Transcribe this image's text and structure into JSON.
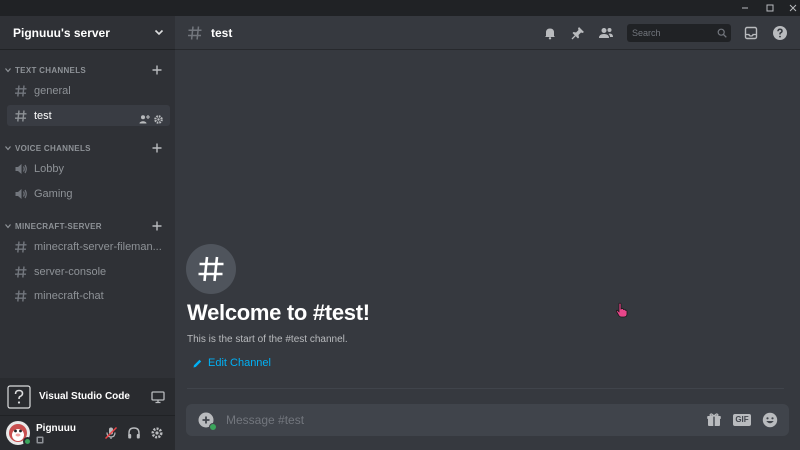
{
  "window": {
    "controls": [
      "minimize-icon",
      "maximize-icon",
      "close-icon"
    ]
  },
  "server": {
    "name": "Pignuuu's server"
  },
  "categories": [
    {
      "label": "TEXT CHANNELS",
      "channels": [
        {
          "label": "general",
          "type": "text",
          "icon": "hash-icon",
          "active": false
        },
        {
          "label": "test",
          "type": "text",
          "icon": "hash-icon",
          "active": true
        }
      ]
    },
    {
      "label": "VOICE CHANNELS",
      "channels": [
        {
          "label": "Lobby",
          "type": "voice",
          "icon": "speaker-icon",
          "active": false
        },
        {
          "label": "Gaming",
          "type": "voice",
          "icon": "speaker-icon",
          "active": false
        }
      ]
    },
    {
      "label": "MINECRAFT-SERVER",
      "channels": [
        {
          "label": "minecraft-server-fileman...",
          "type": "text",
          "icon": "hash-icon",
          "active": false
        },
        {
          "label": "server-console",
          "type": "text",
          "icon": "hash-icon",
          "active": false
        },
        {
          "label": "minecraft-chat",
          "type": "text",
          "icon": "hash-icon",
          "active": false
        }
      ]
    }
  ],
  "activity": {
    "name": "Visual Studio Code",
    "icon": "question-mark-icon"
  },
  "user": {
    "name": "Pignuuu",
    "status_color": "#3ba55c",
    "controls": [
      "mute-mic-icon",
      "headphones-icon",
      "settings-gear-icon"
    ]
  },
  "channel_header": {
    "title": "test",
    "search_placeholder": "Search",
    "icons": [
      "bell-icon",
      "pin-icon",
      "members-icon",
      "inbox-icon",
      "help-icon"
    ]
  },
  "welcome": {
    "title": "Welcome to #test!",
    "subtitle": "This is the start of the #test channel.",
    "edit_label": "Edit Channel"
  },
  "composer": {
    "placeholder": "Message #test",
    "icons": [
      "add-attachment-icon",
      "gift-icon",
      "gif-icon",
      "emoji-icon"
    ],
    "gif_label": "GIF"
  },
  "colors": {
    "accent_link": "#00b0f4",
    "online": "#3ba55c",
    "background": "#36393f",
    "sidebar": "#2f3136"
  }
}
